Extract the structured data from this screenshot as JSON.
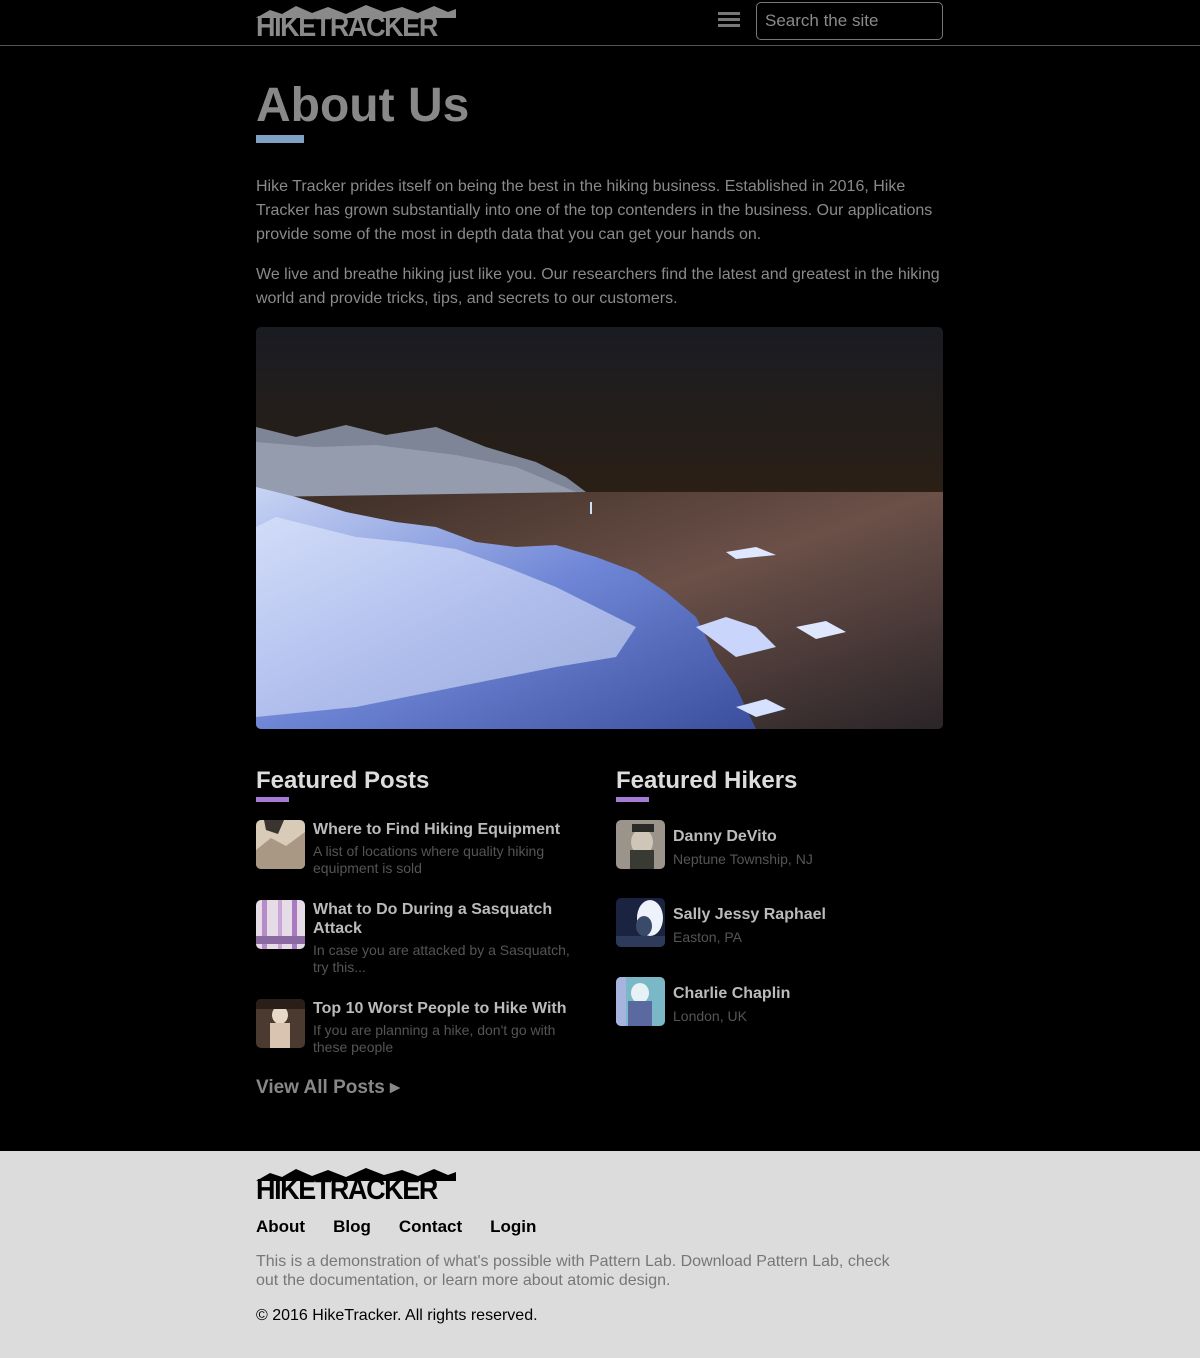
{
  "header": {
    "logo_text": "HIKETRACKER",
    "search_placeholder": "Search the site"
  },
  "main": {
    "title": "About Us",
    "paragraphs": [
      "Hike Tracker prides itself on being the best in the hiking business. Established in 2016, Hike Tracker has grown substantially into one of the top contenders in the business. Our applications provide some of the most in depth data that you can get your hands on.",
      "We live and breathe hiking just like you. Our researchers find the latest and greatest in the hiking world and provide tricks, tips, and secrets to our customers."
    ]
  },
  "featured_posts": {
    "title": "Featured Posts",
    "items": [
      {
        "title": "Where to Find Hiking Equipment",
        "desc": "A list of locations where quality hiking equipment is sold"
      },
      {
        "title": "What to Do During a Sasquatch Attack",
        "desc": "In case you are attacked by a Sasquatch, try this..."
      },
      {
        "title": "Top 10 Worst People to Hike With",
        "desc": "If you are planning a hike, don't go with these people"
      }
    ],
    "view_all": "View All Posts ▸"
  },
  "featured_hikers": {
    "title": "Featured Hikers",
    "items": [
      {
        "name": "Danny DeVito",
        "location": "Neptune Township, NJ"
      },
      {
        "name": "Sally Jessy Raphael",
        "location": "Easton, PA"
      },
      {
        "name": "Charlie Chaplin",
        "location": "London, UK"
      }
    ]
  },
  "footer": {
    "logo_text": "HIKETRACKER",
    "nav": [
      "About",
      "Blog",
      "Contact",
      "Login"
    ],
    "description": "This is a demonstration of what's possible with Pattern Lab. Download Pattern Lab, check out the documentation, or learn more about atomic design.",
    "copyright": "© 2016 HikeTracker. All rights reserved."
  },
  "colors": {
    "background": "#000000",
    "title_accent": "#7ea1c4",
    "section_accent": "#a67dd6",
    "footer_bg": "#dcdcdc"
  }
}
